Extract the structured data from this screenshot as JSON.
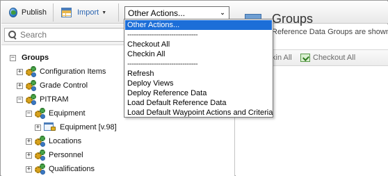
{
  "toolbar": {
    "publish_label": "Publish",
    "import_label": "Import",
    "actions_selected": "Other Actions..."
  },
  "search": {
    "placeholder": "Search"
  },
  "tree": {
    "root": "Groups",
    "items": [
      {
        "label": "Configuration Items",
        "toggle": "+"
      },
      {
        "label": "Grade Control",
        "toggle": "+"
      },
      {
        "label": "PITRAM",
        "toggle": "−"
      },
      {
        "label": "Equipment",
        "toggle": "−"
      },
      {
        "label": "Equipment [v.98]",
        "toggle": "+"
      },
      {
        "label": "Locations",
        "toggle": "+"
      },
      {
        "label": "Personnel",
        "toggle": "+"
      },
      {
        "label": "Qualifications",
        "toggle": "+"
      }
    ],
    "root_toggle": "−"
  },
  "right_pane": {
    "title": "Groups",
    "subtitle": "Reference Data Groups are shown",
    "checkin_label": "kin All",
    "checkout_label": "Checkout All"
  },
  "dropdown": {
    "options": [
      "Other Actions...",
      "--------------------------------",
      "Checkout All",
      "Checkin All",
      "--------------------------------",
      "Refresh",
      "Deploy Views",
      "Deploy Reference Data",
      "Load Default Reference Data",
      "Load Default Waypoint Actions and Criteria"
    ],
    "selected_index": 0
  },
  "colors": {
    "selection": "#1c6ed8",
    "import_text": "#2a64b0"
  }
}
